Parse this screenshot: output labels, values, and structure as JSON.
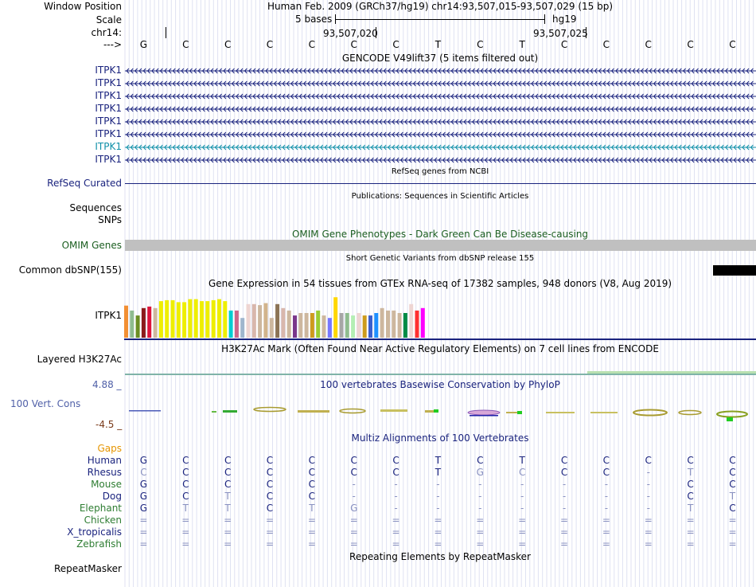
{
  "header": {
    "window_position_label": "Window Position",
    "scale_label": "Scale",
    "chrom_label": "chr14:",
    "arrow_label": "--->",
    "assembly_position": "Human Feb. 2009 (GRCh37/hg19)   chr14:93,507,015-93,507,029 (15 bp)",
    "scale_text": "5 bases",
    "scale_db": "hg19",
    "coord_1": "93,507,020",
    "coord_2": "93,507,025"
  },
  "sequence": [
    "G",
    "C",
    "C",
    "C",
    "C",
    "C",
    "C",
    "T",
    "C",
    "T",
    "C",
    "C",
    "C",
    "C",
    "C"
  ],
  "gencode": {
    "title": "GENCODE V49lift37 (5 items filtered out)",
    "items": [
      {
        "label": "ITPK1",
        "color": "#1a237e"
      },
      {
        "label": "ITPK1",
        "color": "#1a237e"
      },
      {
        "label": "ITPK1",
        "color": "#1a237e"
      },
      {
        "label": "ITPK1",
        "color": "#1a237e"
      },
      {
        "label": "ITPK1",
        "color": "#1a237e"
      },
      {
        "label": "ITPK1",
        "color": "#1a237e"
      },
      {
        "label": "ITPK1",
        "color": "#0e8fa8"
      },
      {
        "label": "ITPK1",
        "color": "#1a237e"
      }
    ]
  },
  "refseq": {
    "title": "RefSeq genes from NCBI",
    "label": "RefSeq Curated"
  },
  "publications": {
    "title": "Publications: Sequences in Scientific Articles",
    "label": "Sequences"
  },
  "snps": {
    "label": "SNPs"
  },
  "omim": {
    "title": "OMIM Gene Phenotypes - Dark Green Can Be Disease-causing",
    "label": "OMIM Genes"
  },
  "dbsnp": {
    "title": "Short Genetic Variants from dbSNP release 155",
    "label": "Common dbSNP(155)"
  },
  "gtex": {
    "title": "Gene Expression in 54 tissues from GTEx RNA-seq of 17382 samples, 948 donors (V8, Aug 2019)",
    "label": "ITPK1",
    "bars": [
      {
        "v": 0.65,
        "c": "#f28f33"
      },
      {
        "v": 0.55,
        "c": "#8fbc8f"
      },
      {
        "v": 0.45,
        "c": "#6b8e23"
      },
      {
        "v": 0.6,
        "c": "#8b1a1a"
      },
      {
        "v": 0.63,
        "c": "#dc143c"
      },
      {
        "v": 0.6,
        "c": "#cdb79e"
      },
      {
        "v": 0.74,
        "c": "#eeee00"
      },
      {
        "v": 0.76,
        "c": "#eeee00"
      },
      {
        "v": 0.76,
        "c": "#eeee00"
      },
      {
        "v": 0.72,
        "c": "#eeee00"
      },
      {
        "v": 0.72,
        "c": "#eeee00"
      },
      {
        "v": 0.78,
        "c": "#eeee00"
      },
      {
        "v": 0.78,
        "c": "#eeee00"
      },
      {
        "v": 0.74,
        "c": "#eeee00"
      },
      {
        "v": 0.74,
        "c": "#eeee00"
      },
      {
        "v": 0.76,
        "c": "#eeee00"
      },
      {
        "v": 0.78,
        "c": "#eeee00"
      },
      {
        "v": 0.74,
        "c": "#eeee00"
      },
      {
        "v": 0.55,
        "c": "#00ced1"
      },
      {
        "v": 0.55,
        "c": "#cd6889"
      },
      {
        "v": 0.4,
        "c": "#9fb6cd"
      },
      {
        "v": 0.68,
        "c": "#eed5d2"
      },
      {
        "v": 0.68,
        "c": "#d9b7ac"
      },
      {
        "v": 0.66,
        "c": "#cdb79e"
      },
      {
        "v": 0.7,
        "c": "#d2b48c"
      },
      {
        "v": 0.4,
        "c": "#cdb79e"
      },
      {
        "v": 0.68,
        "c": "#8b7355"
      },
      {
        "v": 0.6,
        "c": "#d9b7ac"
      },
      {
        "v": 0.55,
        "c": "#cdb79e"
      },
      {
        "v": 0.45,
        "c": "#7a378b"
      },
      {
        "v": 0.5,
        "c": "#cdb79e"
      },
      {
        "v": 0.5,
        "c": "#cdb79e"
      },
      {
        "v": 0.5,
        "c": "#cd9b1d"
      },
      {
        "v": 0.55,
        "c": "#9acd32"
      },
      {
        "v": 0.45,
        "c": "#cdb79e"
      },
      {
        "v": 0.4,
        "c": "#7777ff"
      },
      {
        "v": 0.82,
        "c": "#ffd700"
      },
      {
        "v": 0.5,
        "c": "#a6a6a6"
      },
      {
        "v": 0.5,
        "c": "#8fbc8f"
      },
      {
        "v": 0.45,
        "c": "#b4eeb4"
      },
      {
        "v": 0.5,
        "c": "#eed5d2"
      },
      {
        "v": 0.45,
        "c": "#cd9b1d"
      },
      {
        "v": 0.45,
        "c": "#3a5fcd"
      },
      {
        "v": 0.5,
        "c": "#1e90ff"
      },
      {
        "v": 0.6,
        "c": "#cdb79e"
      },
      {
        "v": 0.55,
        "c": "#cdb79e"
      },
      {
        "v": 0.55,
        "c": "#cdb79e"
      },
      {
        "v": 0.5,
        "c": "#cdb79e"
      },
      {
        "v": 0.5,
        "c": "#008b45"
      },
      {
        "v": 0.68,
        "c": "#eed5d2"
      },
      {
        "v": 0.55,
        "c": "#ff3030"
      },
      {
        "v": 0.6,
        "c": "#ff00ff"
      }
    ]
  },
  "h3k27ac": {
    "title": "H3K27Ac Mark (Often Found Near Active Regulatory Elements) on 7 cell lines from ENCODE",
    "label": "Layered H3K27Ac"
  },
  "conservation": {
    "title": "100 vertebrates Basewise Conservation by PhyloP",
    "label": "100 Vert. Cons",
    "max": "4.88 _",
    "min": "-4.5 _"
  },
  "multiz": {
    "title": "Multiz Alignments of 100 Vertebrates",
    "gaps_label": "Gaps",
    "species": [
      {
        "name": "Human",
        "color": "#1a237e",
        "seq": [
          "G",
          "C",
          "C",
          "C",
          "C",
          "C",
          "C",
          "T",
          "C",
          "T",
          "C",
          "C",
          "C",
          "C",
          "C"
        ]
      },
      {
        "name": "Rhesus",
        "color": "#1a237e",
        "seq": [
          "C",
          "C",
          "C",
          "C",
          "C",
          "C",
          "C",
          "T",
          "G",
          "C",
          "C",
          "C",
          "-",
          "T",
          "C"
        ]
      },
      {
        "name": "Mouse",
        "color": "#2e7d32",
        "seq": [
          "G",
          "C",
          "C",
          "C",
          "C",
          "-",
          "-",
          "-",
          "-",
          "-",
          "-",
          "-",
          "-",
          "C",
          "C"
        ]
      },
      {
        "name": "Dog",
        "color": "#1a237e",
        "seq": [
          "G",
          "C",
          "T",
          "C",
          "C",
          "-",
          "-",
          "-",
          "-",
          "-",
          "-",
          "-",
          "-",
          "C",
          "T"
        ]
      },
      {
        "name": "Elephant",
        "color": "#2e7d32",
        "seq": [
          "G",
          "T",
          "T",
          "C",
          "T",
          "G",
          "-",
          "-",
          "-",
          "-",
          "-",
          "-",
          "-",
          "T",
          "C"
        ]
      },
      {
        "name": "Chicken",
        "color": "#2e7d32",
        "seq": [
          "=",
          "=",
          "=",
          "=",
          "=",
          "=",
          "=",
          "=",
          "=",
          "=",
          "=",
          "=",
          "=",
          "=",
          "="
        ]
      },
      {
        "name": "X_tropicalis",
        "color": "#1a237e",
        "seq": [
          "=",
          "=",
          "=",
          "=",
          "=",
          "=",
          "=",
          "=",
          "=",
          "=",
          "=",
          "=",
          "=",
          "=",
          "="
        ]
      },
      {
        "name": "Zebrafish",
        "color": "#2e7d32",
        "seq": [
          "=",
          "=",
          "=",
          "=",
          "=",
          "=",
          "=",
          "=",
          "=",
          "=",
          "=",
          "=",
          "=",
          "=",
          "="
        ]
      }
    ]
  },
  "repeatmasker": {
    "title": "Repeating Elements by RepeatMasker",
    "label": "RepeatMasker"
  },
  "colors": {
    "navy": "#1a237e",
    "omim_green": "#1b5e20",
    "gaps": "#e69500",
    "grid": "#c8cce8",
    "cons_label": "#5060a8",
    "cons_neg": "#7a3a1a"
  }
}
